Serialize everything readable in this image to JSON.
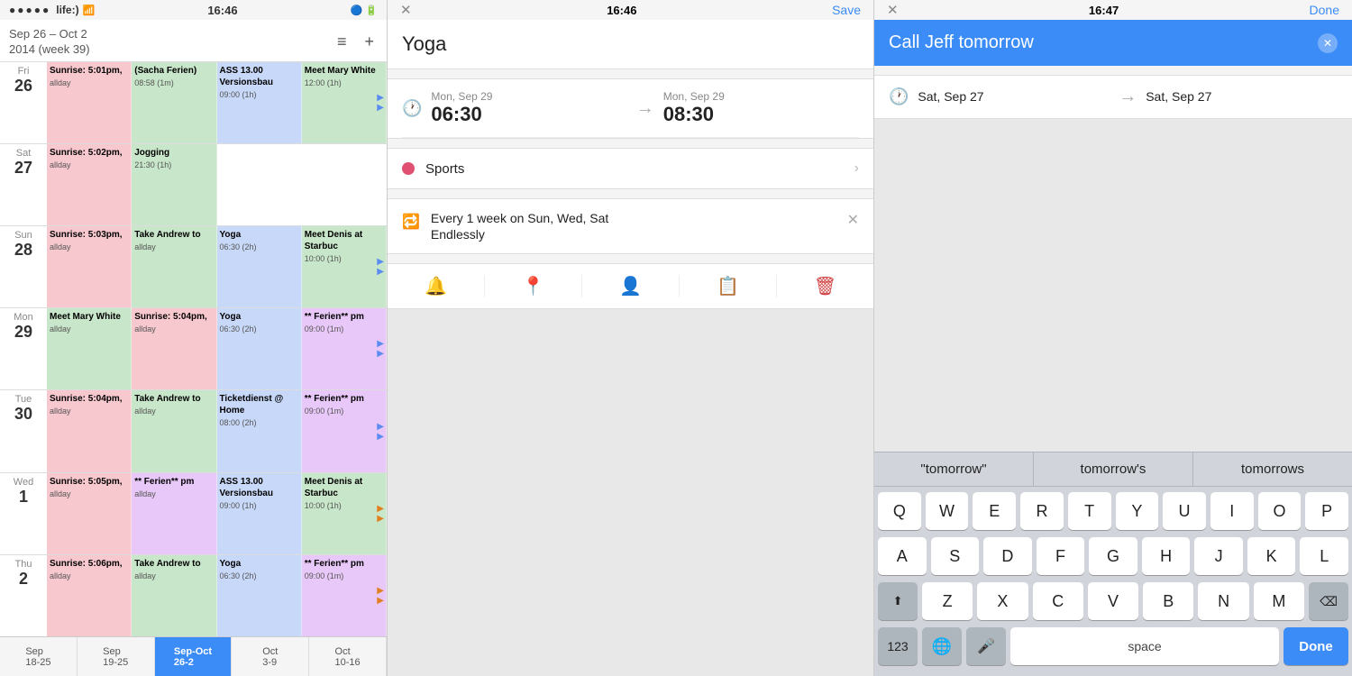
{
  "panel1": {
    "status": {
      "dots": "●●●●●",
      "carrier": "life:)",
      "wifi": "📶",
      "time": "16:46",
      "bluetooth": "🔵",
      "battery": "🔋"
    },
    "header": {
      "title": "Sep 26 – Oct 2",
      "subtitle": "2014 (week 39)",
      "menu_label": "≡",
      "add_label": "+"
    },
    "rows": [
      {
        "day_name": "Fri",
        "day_num": "26",
        "is_today": false,
        "events": [
          {
            "title": "Sunrise: 5:01pm,",
            "time": "allday",
            "color": "pink",
            "arrow": ""
          },
          {
            "title": "(Sacha Ferien)",
            "time": "08:58 (1m)",
            "color": "green",
            "arrow": ""
          },
          {
            "title": "ASS 13.00 Versionsbau",
            "time": "09:00 (1h)",
            "color": "blue",
            "arrow": ""
          },
          {
            "title": "Meet Mary White",
            "time": "12:00 (1h)",
            "color": "green",
            "arrow": "blue"
          }
        ]
      },
      {
        "day_name": "Sat",
        "day_num": "27",
        "is_today": false,
        "events": [
          {
            "title": "Sunrise: 5:02pm,",
            "time": "allday",
            "color": "pink",
            "arrow": ""
          },
          {
            "title": "Jogging",
            "time": "21:30 (1h)",
            "color": "green",
            "arrow": ""
          },
          {
            "title": "",
            "time": "",
            "color": "empty",
            "arrow": ""
          },
          {
            "title": "",
            "time": "",
            "color": "empty",
            "arrow": ""
          }
        ]
      },
      {
        "day_name": "Sun",
        "day_num": "28",
        "is_today": false,
        "events": [
          {
            "title": "Sunrise: 5:03pm,",
            "time": "allday",
            "color": "pink",
            "arrow": ""
          },
          {
            "title": "Take Andrew to",
            "time": "allday",
            "color": "green",
            "arrow": ""
          },
          {
            "title": "Yoga",
            "time": "06:30 (2h)",
            "color": "blue",
            "arrow": ""
          },
          {
            "title": "Meet Denis at Starbuc",
            "time": "10:00 (1h)",
            "color": "green",
            "arrow": "blue"
          }
        ]
      },
      {
        "day_name": "Mon",
        "day_num": "29",
        "is_today": false,
        "events": [
          {
            "title": "Meet Mary White",
            "time": "allday",
            "color": "green",
            "arrow": ""
          },
          {
            "title": "Sunrise: 5:04pm,",
            "time": "allday",
            "color": "pink",
            "arrow": ""
          },
          {
            "title": "Yoga",
            "time": "06:30 (2h)",
            "color": "blue",
            "arrow": ""
          },
          {
            "title": "** Ferien** pm",
            "time": "09:00 (1m)",
            "color": "purple",
            "arrow": "blue"
          }
        ]
      },
      {
        "day_name": "Tue",
        "day_num": "30",
        "is_today": false,
        "events": [
          {
            "title": "Sunrise: 5:04pm,",
            "time": "allday",
            "color": "pink",
            "arrow": ""
          },
          {
            "title": "Take Andrew to",
            "time": "allday",
            "color": "green",
            "arrow": ""
          },
          {
            "title": "Ticketdienst @ Home",
            "time": "08:00 (2h)",
            "color": "blue",
            "arrow": ""
          },
          {
            "title": "** Ferien** pm",
            "time": "09:00 (1m)",
            "color": "purple",
            "arrow": "blue"
          }
        ]
      },
      {
        "day_name": "Wed",
        "day_num": "1",
        "is_today": false,
        "events": [
          {
            "title": "Sunrise: 5:05pm,",
            "time": "allday",
            "color": "pink",
            "arrow": ""
          },
          {
            "title": "** Ferien** pm",
            "time": "allday",
            "color": "purple",
            "arrow": ""
          },
          {
            "title": "ASS 13.00 Versionsbau",
            "time": "09:00 (1h)",
            "color": "blue",
            "arrow": ""
          },
          {
            "title": "Meet Denis at Starbuc",
            "time": "10:00 (1h)",
            "color": "green",
            "arrow": "orange"
          }
        ]
      },
      {
        "day_name": "Thu",
        "day_num": "2",
        "is_today": false,
        "events": [
          {
            "title": "Sunrise: 5:06pm,",
            "time": "allday",
            "color": "pink",
            "arrow": ""
          },
          {
            "title": "Take Andrew to",
            "time": "allday",
            "color": "green",
            "arrow": ""
          },
          {
            "title": "Yoga",
            "time": "06:30 (2h)",
            "color": "blue",
            "arrow": ""
          },
          {
            "title": "** Ferien** pm",
            "time": "09:00 (1m)",
            "color": "purple",
            "arrow": "orange"
          }
        ]
      }
    ],
    "week_tabs": [
      {
        "label": "Sep\n18-25",
        "active": false
      },
      {
        "label": "Sep\n19-25",
        "active": false
      },
      {
        "label": "Sep-Oct\n26-2",
        "active": true
      },
      {
        "label": "Oct\n3-9",
        "active": false
      },
      {
        "label": "Oct\n10-16",
        "active": false
      }
    ]
  },
  "panel2": {
    "status": {
      "time": "16:46"
    },
    "close_label": "✕",
    "save_label": "Save",
    "event_title": "Yoga",
    "time_start_label": "Mon, Sep 29",
    "time_start_value": "06:30",
    "time_end_label": "Mon, Sep 29",
    "time_end_value": "08:30",
    "calendar_label": "Sports",
    "recur_line1": "Every 1 week on Sun, Wed, Sat",
    "recur_line2": "Endlessly",
    "toolbar": {
      "bell": "🔔",
      "pin": "📍",
      "person": "👤",
      "note": "📋",
      "trash": "🗑"
    }
  },
  "panel3": {
    "status": {
      "time": "16:47"
    },
    "close_label": "✕",
    "done_label": "Done",
    "input_value": "Call Jeff tomorrow",
    "clear_label": "✕",
    "date_label": "Sat, Sep 27",
    "date_end_label": "Sat, Sep 27",
    "autocomplete": [
      "\"tomorrow\"",
      "tomorrow's",
      "tomorrows"
    ],
    "keyboard": {
      "row1": [
        "Q",
        "W",
        "E",
        "R",
        "T",
        "Y",
        "U",
        "I",
        "O",
        "P"
      ],
      "row2": [
        "A",
        "S",
        "D",
        "F",
        "G",
        "H",
        "J",
        "K",
        "L"
      ],
      "row3": [
        "Z",
        "X",
        "C",
        "V",
        "B",
        "N",
        "M"
      ],
      "special": {
        "shift": "⬆",
        "delete": "⌫",
        "num": "123",
        "globe": "🌐",
        "mic": "🎤",
        "space": "space",
        "done": "Done"
      }
    }
  }
}
